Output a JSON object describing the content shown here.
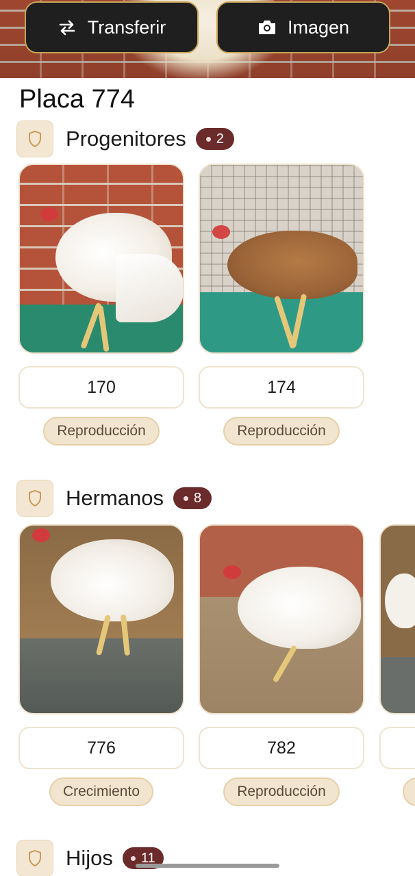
{
  "header": {
    "transfer_label": "Transferir",
    "image_label": "Imagen",
    "back_icon": "arrow-left-icon",
    "transfer_icon": "swap-arrows-icon",
    "image_icon": "camera-icon"
  },
  "page": {
    "title": "Placa 774"
  },
  "sections": {
    "progenitores": {
      "title": "Progenitores",
      "count": "2",
      "icon": "shield-icon",
      "items": [
        {
          "number": "170",
          "status": "Reproducción"
        },
        {
          "number": "174",
          "status": "Reproducción"
        }
      ]
    },
    "hermanos": {
      "title": "Hermanos",
      "count": "8",
      "icon": "shield-icon",
      "items": [
        {
          "number": "776",
          "status": "Crecimiento"
        },
        {
          "number": "782",
          "status": "Reproducción"
        }
      ]
    },
    "hijos": {
      "title": "Hijos",
      "count": "11",
      "icon": "shield-icon"
    }
  },
  "colors": {
    "accent_gold": "#c8a55a",
    "badge_maroon": "#6b2b2b",
    "pill_beige": "#f2e5cf"
  }
}
